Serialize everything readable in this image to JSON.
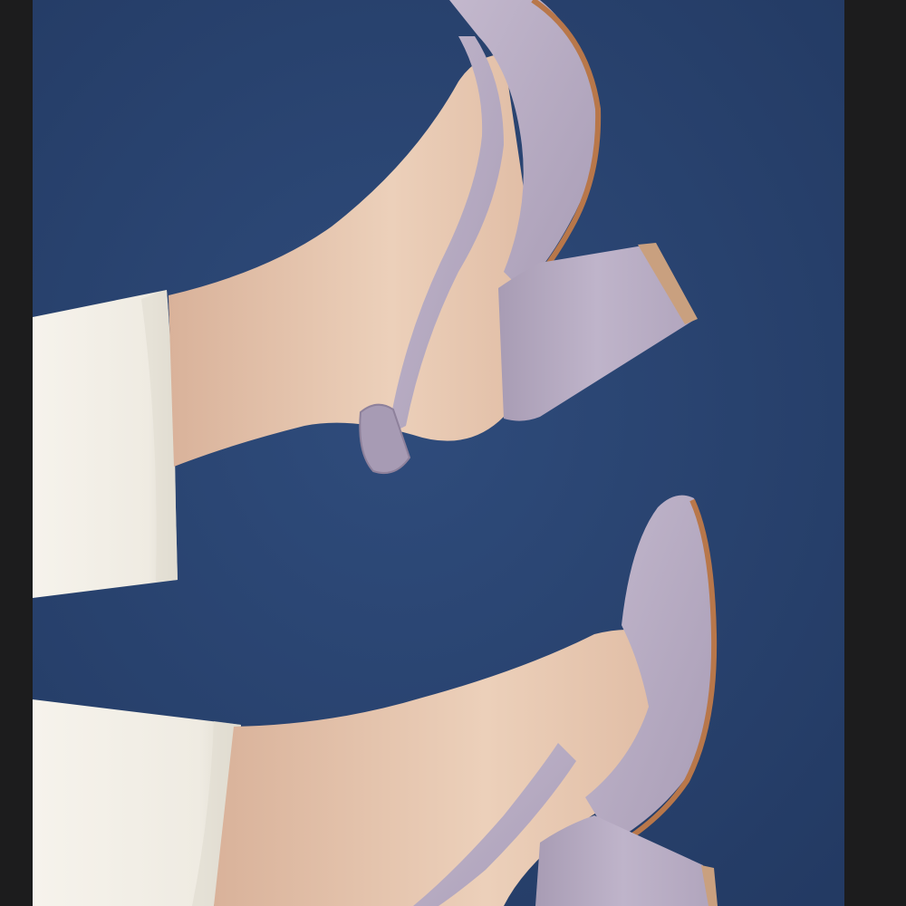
{
  "image": {
    "subject": "product-photo",
    "palette": {
      "backdrop": "#27406b",
      "backdrop_light": "#2d4a7a",
      "skin": "#e8c6ad",
      "skin_shadow": "#cfa48a",
      "suede": "#b9adc4",
      "suede_shadow": "#9d90aa",
      "sole_edge": "#b8774a",
      "trousers": "#f3f0e8",
      "trousers_shadow": "#dcd8cc",
      "border": "#1c1c1d"
    }
  }
}
